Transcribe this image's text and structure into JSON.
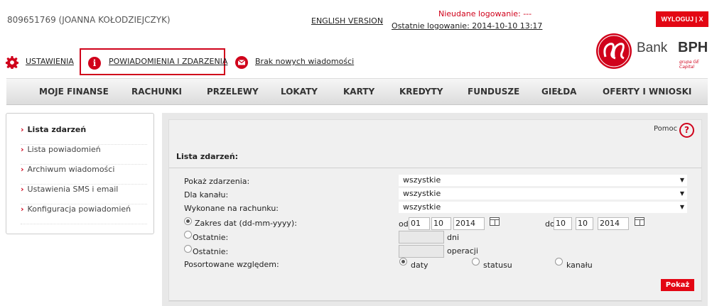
{
  "header": {
    "user": "809651769 (JOANNA KOŁODZIEJCZYK)",
    "english_version": "ENGLISH VERSION",
    "failed_logins": "Nieudane logowanie: ---",
    "last_login": "Ostatnie logowanie: 2014-10-10 13:17",
    "logout": "WYLOGUJ | X"
  },
  "toplinks": {
    "settings": "USTAWIENIA",
    "notifications": "POWIADOMIENIA I ZDARZENIA",
    "messages": "Brak nowych wiadomości"
  },
  "logo": {
    "text": "Bank",
    "bold": "BPH",
    "sub": "grupa GE Capital"
  },
  "nav": [
    "MOJE FINANSE",
    "RACHUNKI",
    "PRZELEWY",
    "LOKATY",
    "KARTY",
    "KREDYTY",
    "FUNDUSZE",
    "GIEŁDA",
    "OFERTY I WNIOSKI"
  ],
  "sidebar": [
    {
      "label": "Lista zdarzeń"
    },
    {
      "label": "Lista powiadomień"
    },
    {
      "label": "Archiwum wiadomości"
    },
    {
      "label": "Ustawienia SMS i email"
    },
    {
      "label": "Konfiguracja powiadomień"
    }
  ],
  "main": {
    "help": "Pomoc",
    "help_icon": "?",
    "title": "Lista zdarzeń:",
    "labels": {
      "show_events": "Pokaż zdarzenia:",
      "channel": "Dla kanału:",
      "account": "Wykonane na rachunku:",
      "date_range": "Zakres dat (dd-mm-yyyy):",
      "last_days": "Ostatnie:",
      "last_ops": "Ostatnie:",
      "sort_by": "Posortowane względem:"
    },
    "selects": {
      "show_events": "wszystkie",
      "channel": "wszystkie",
      "account": "wszystkie"
    },
    "date_from": {
      "prefix": "od",
      "dd": "01",
      "mm": "10",
      "yyyy": "2014"
    },
    "date_to": {
      "prefix": "do",
      "dd": "10",
      "mm": "10",
      "yyyy": "2014"
    },
    "days_unit": "dni",
    "ops_unit": "operacji",
    "sort": {
      "date": "daty",
      "status": "statusu",
      "channel": "kanału"
    },
    "submit": "Pokaż"
  }
}
